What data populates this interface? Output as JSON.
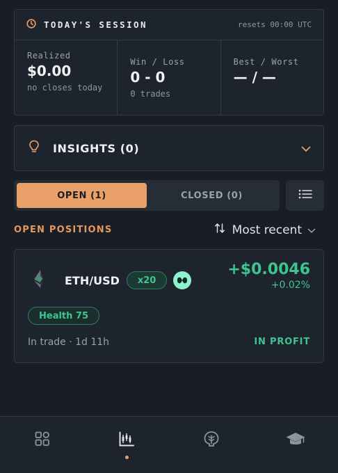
{
  "session": {
    "title": "TODAY'S SESSION",
    "resets": "resets 00:00 UTC",
    "realized_label": "Realized",
    "realized_value": "$0.00",
    "realized_sub": "no closes today",
    "winloss_label": "Win / Loss",
    "winloss_value": "0 - 0",
    "winloss_sub": "0 trades",
    "bestworst_label": "Best / Worst",
    "bestworst_value": "— / —"
  },
  "insights": {
    "title": "INSIGHTS (0)",
    "icon": "lightbulb-icon"
  },
  "tabs": [
    {
      "label": "OPEN (1)",
      "active": true
    },
    {
      "label": "CLOSED (0)",
      "active": false
    }
  ],
  "positions_section": {
    "title": "OPEN POSITIONS",
    "sort_label": "Most recent"
  },
  "position": {
    "pair": "ETH/USD",
    "leverage": "x20",
    "pnl": "+$0.0046",
    "pnl_pct": "+0.02%",
    "health": "Health 75",
    "duration": "In trade · 1d 11h",
    "status": "IN PROFIT"
  },
  "nav": [
    {
      "icon": "dashboard-icon",
      "active": false
    },
    {
      "icon": "chart-icon",
      "active": true
    },
    {
      "icon": "tree-icon",
      "active": false
    },
    {
      "icon": "graduation-cap-icon",
      "active": false
    }
  ],
  "colors": {
    "accent": "#e9a068",
    "profit": "#3ec48f",
    "background": "#191e26",
    "card": "#1e242d"
  }
}
